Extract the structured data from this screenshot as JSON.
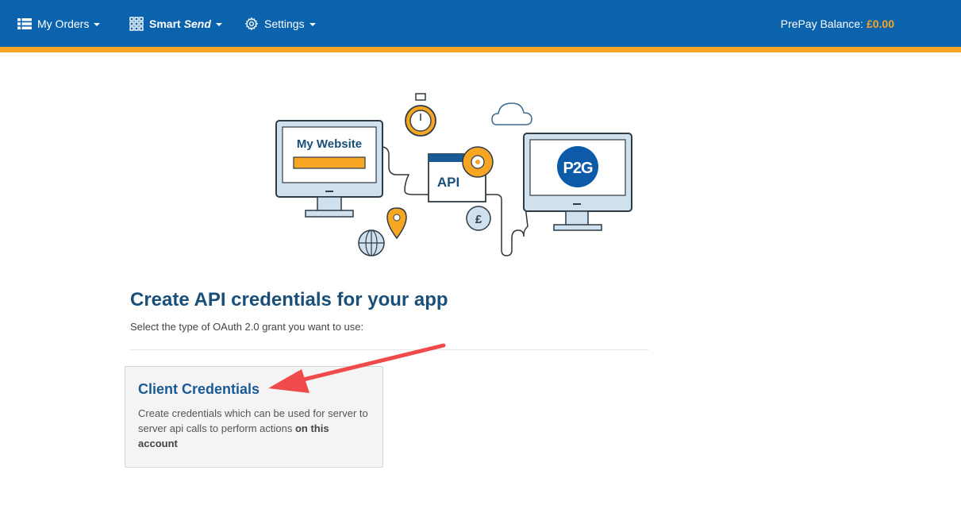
{
  "nav": {
    "orders_label": "My Orders",
    "smart_label": "Smart",
    "send_label": "Send",
    "settings_label": "Settings",
    "balance_label": "PrePay Balance:",
    "balance_value": "£0.00"
  },
  "illustration": {
    "website_label": "My Website",
    "api_label": "API",
    "brand_label": "P2G",
    "currency_symbol": "£"
  },
  "main": {
    "title": "Create API credentials for your app",
    "subtitle": "Select the type of OAuth 2.0 grant you want to use:"
  },
  "card": {
    "title": "Client Credentials",
    "desc_prefix": "Create credentials which can be used for server to server api calls to perform actions ",
    "desc_bold": "on this account"
  },
  "colors": {
    "navbar": "#0c63ad",
    "accent": "#f6a623",
    "title": "#1a4f7a",
    "arrow": "#f04a4a"
  }
}
